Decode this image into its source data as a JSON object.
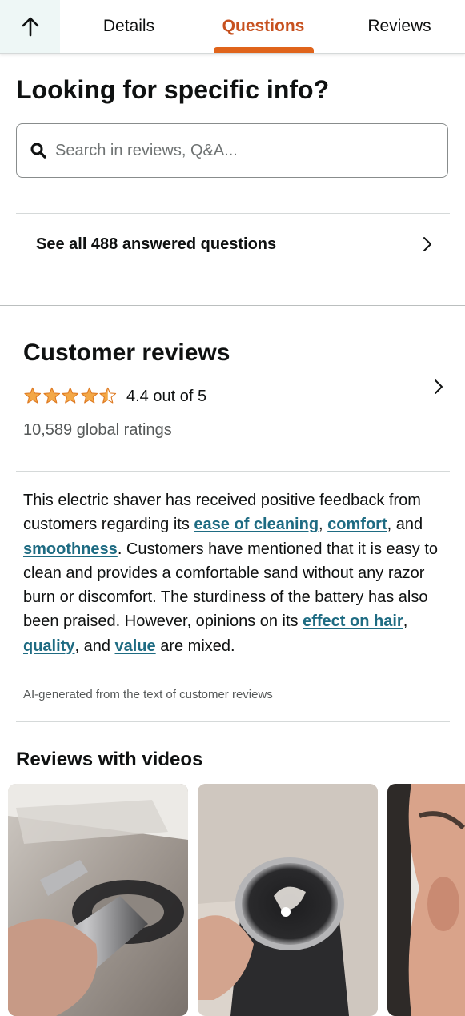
{
  "tabs": {
    "back_icon": "up-arrow-icon",
    "items": [
      {
        "label": "Details"
      },
      {
        "label": "Questions",
        "active": true
      },
      {
        "label": "Reviews"
      }
    ],
    "active_color": "#c7511f"
  },
  "search": {
    "heading": "Looking for specific info?",
    "placeholder": "Search in reviews, Q&A...",
    "icon": "search-icon",
    "questions_link": "See all 488 answered questions"
  },
  "reviews": {
    "heading": "Customer reviews",
    "rating": 4.4,
    "rating_text": "4.4 out of 5",
    "global_ratings": "10,589 global ratings",
    "star_color": "#f3a847",
    "summary": {
      "t1": "This electric shaver has received positive feedback from customers regarding its ",
      "a1": "ease of cleaning",
      "t2": ", ",
      "a2": "comfort",
      "t3": ", and ",
      "a3": "smoothness",
      "t4": ". Customers have mentioned that it is easy to clean and provides a comfortable sand without any razor burn or discomfort. The sturdiness of the battery has also been praised. However, opinions on its ",
      "a4": "effect on hair",
      "t5": ", ",
      "a5": "quality",
      "t6": ", and ",
      "a6": "value",
      "t7": " are mixed."
    },
    "aspect_link_color": "#1e6b82",
    "ai_note": "AI-generated from the text of customer reviews"
  },
  "videos": {
    "heading": "Reviews with videos"
  }
}
